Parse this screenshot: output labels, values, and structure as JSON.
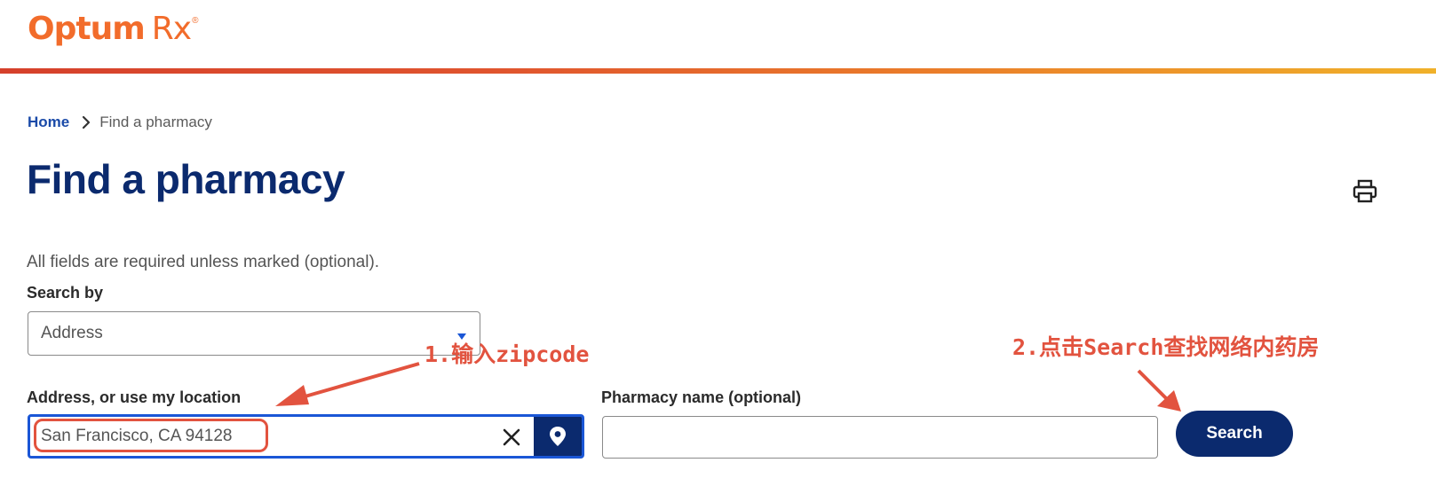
{
  "header": {
    "logo_brand": "Optum",
    "logo_product": "Rx",
    "logo_mark": "®"
  },
  "breadcrumb": {
    "home": "Home",
    "current": "Find a pharmacy"
  },
  "page": {
    "title": "Find a pharmacy",
    "required_note": "All fields are required unless marked (optional)."
  },
  "form": {
    "search_by_label": "Search by",
    "search_by_value": "Address",
    "address_label": "Address, or use my location",
    "address_value": "San Francisco, CA 94128",
    "pharmacy_label": "Pharmacy name (optional)",
    "pharmacy_value": "",
    "search_button": "Search"
  },
  "annotations": {
    "step1": "1.输入zipcode",
    "step2": "2.点击Search查找网络内药房",
    "color": "#e2533f"
  },
  "colors": {
    "brand_orange": "#f26c2b",
    "navy": "#0b2a6e",
    "link_blue": "#1a4aa8",
    "focus_blue": "#1a56d6"
  },
  "icons": {
    "breadcrumb_separator": "chevron-right-icon",
    "print": "printer-icon",
    "clear": "close-icon",
    "location": "map-pin-icon",
    "select": "caret-down-icon"
  }
}
